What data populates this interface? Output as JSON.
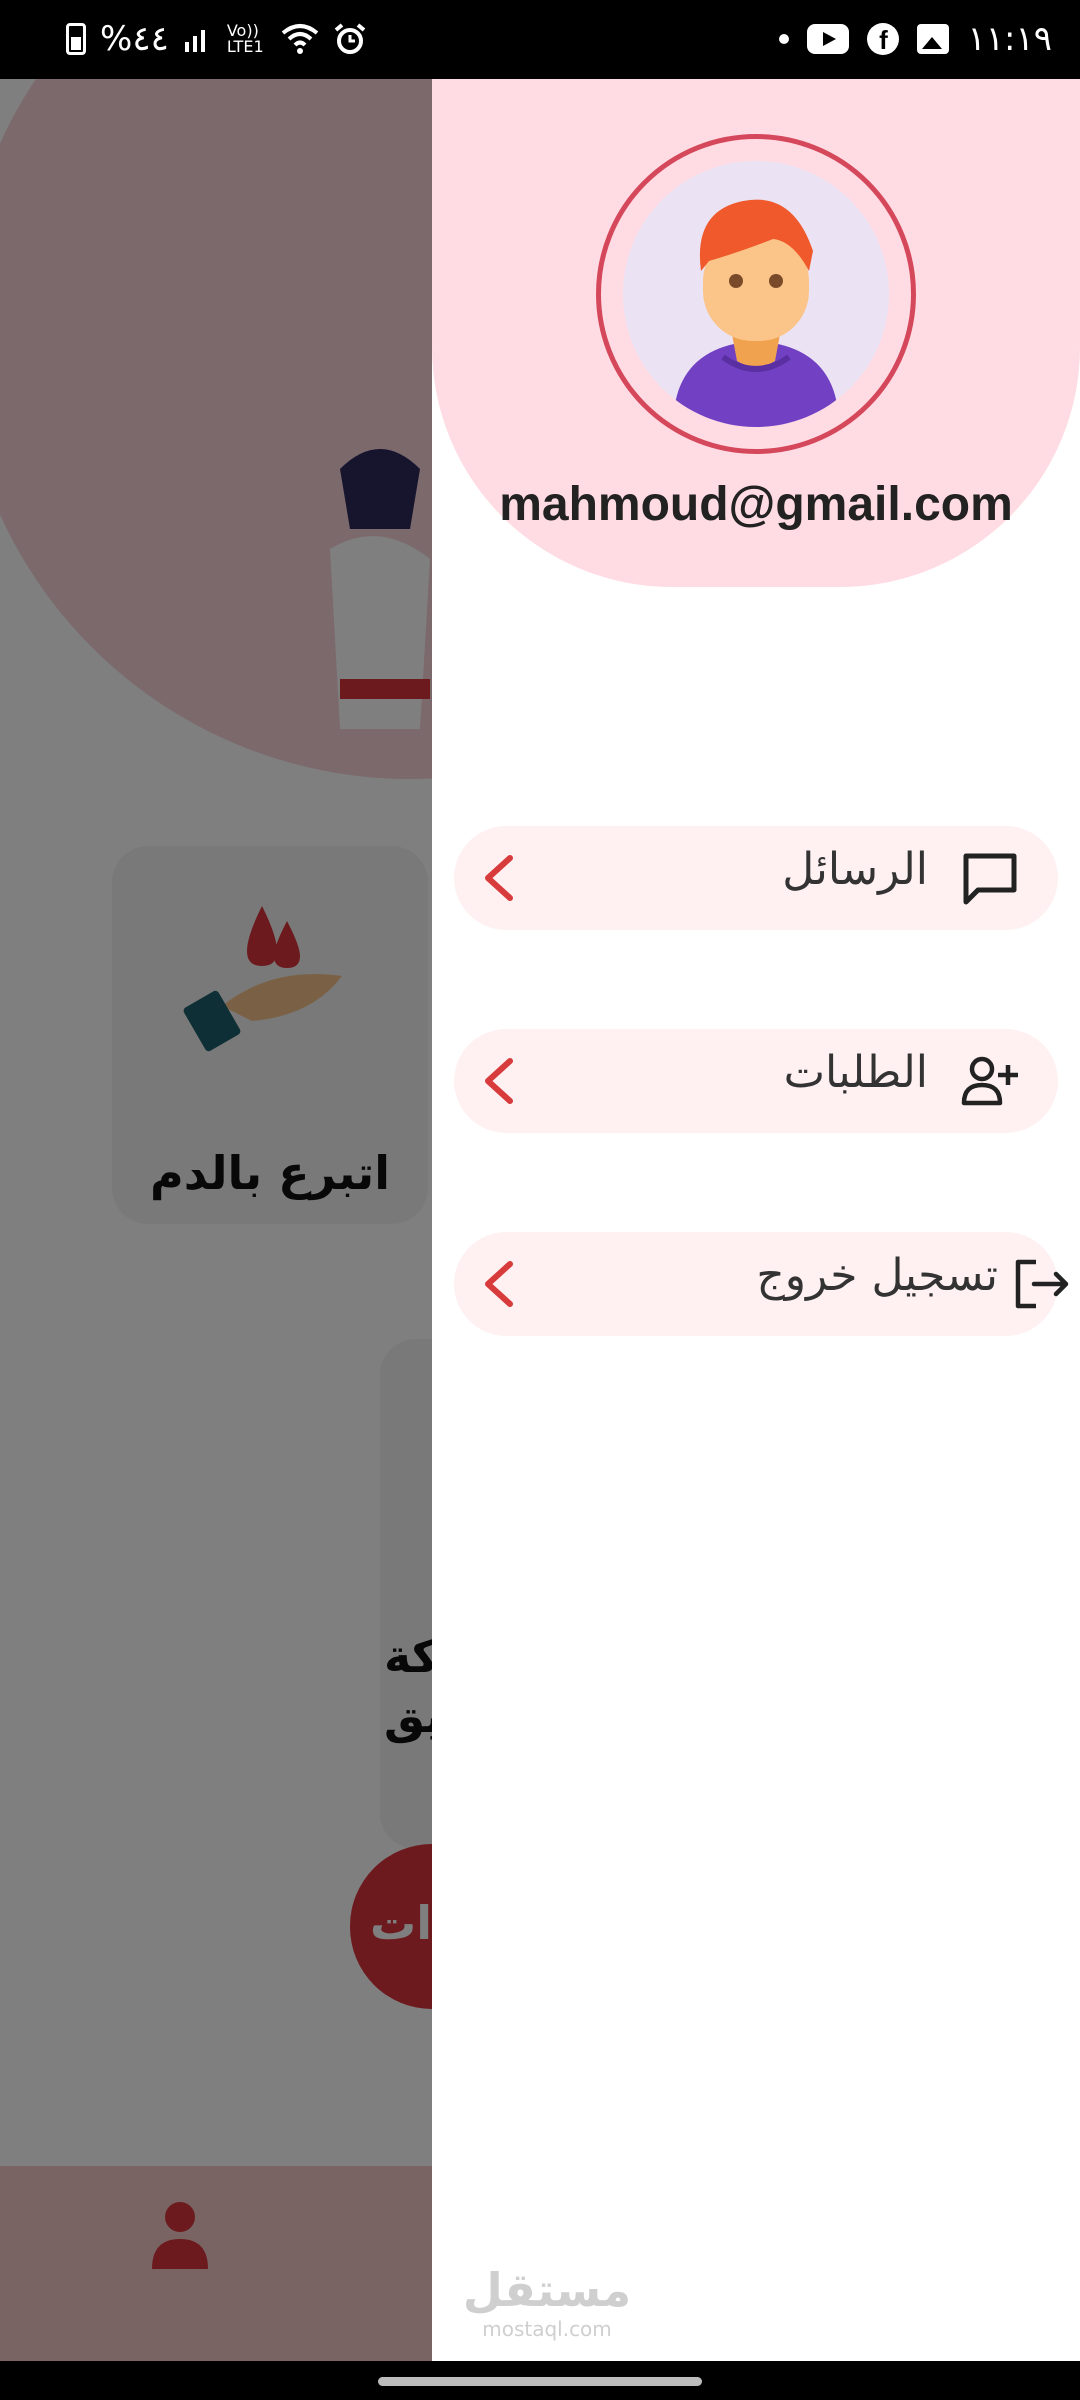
{
  "status_bar": {
    "battery": "%٤٤",
    "network": "Vo)) LTE1",
    "time": "١١:١٩",
    "icons": [
      "battery-icon",
      "signal-icon",
      "wifi-icon",
      "alarm-icon",
      "notification-dot",
      "youtube-icon",
      "facebook-icon",
      "gallery-icon"
    ]
  },
  "background": {
    "donate_card_label": "اتبرع بالدم",
    "card2_line1": "كة",
    "card2_line2": "يق",
    "pill_text": "ات"
  },
  "drawer": {
    "email": "mahmoud@gmail.com",
    "menu": [
      {
        "label": "الرسائل",
        "icon": "message-icon"
      },
      {
        "label": "الطلبات",
        "icon": "add-person-icon"
      },
      {
        "label": "تسجيل خروج",
        "icon": "logout-icon"
      }
    ],
    "watermark_ar": "مستقل",
    "watermark_en": "mostaql.com"
  },
  "colors": {
    "header_pink": "#ffdbe3",
    "avatar_ring": "#d5485b",
    "chevron_red": "#d83b3b",
    "menu_bg": "#fff1f2"
  }
}
